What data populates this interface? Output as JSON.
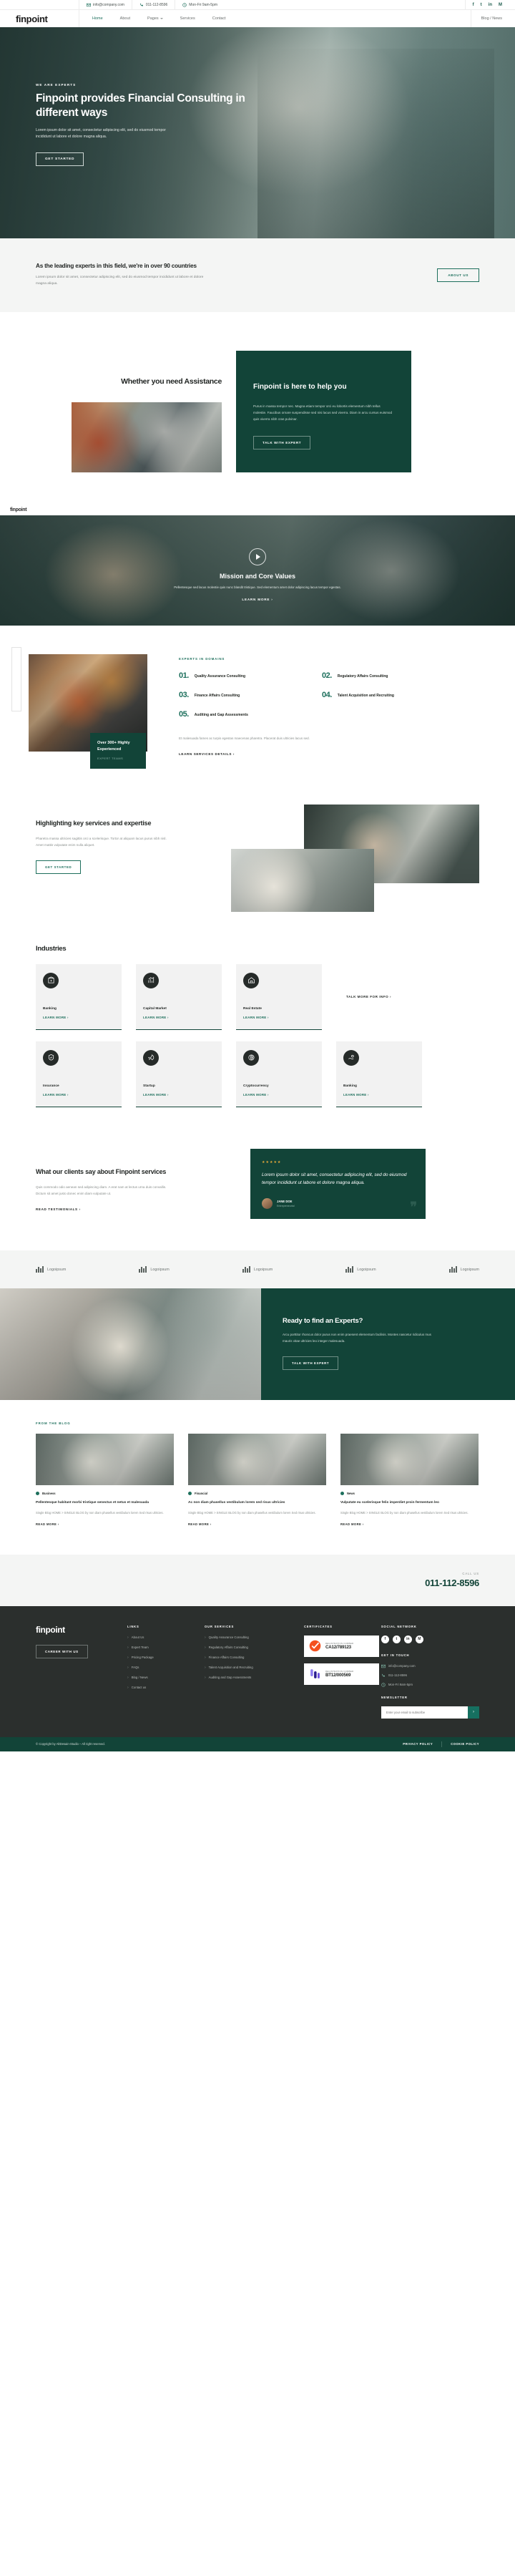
{
  "topbar": {
    "email": "info@company.com",
    "phone": "011-112-8596",
    "hours": "Mon-Fri 9am-5pm",
    "social": [
      "f",
      "t",
      "in",
      "M"
    ]
  },
  "nav": {
    "logo": "finpoint",
    "links": [
      "Home",
      "About",
      "Pages",
      "Services",
      "Contact"
    ],
    "active": "Home",
    "right": "Blog / News"
  },
  "hero": {
    "eyebrow": "WE ARE EXPERTS",
    "title": "Finpoint provides Financial Consulting in different ways",
    "body": "Lorem ipsum dolor sit amet, consectetur adipiscing elit, sed do eiusmod tempor incididunt ut labore et dolore magna aliqua.",
    "cta": "GET STARTED"
  },
  "strip": {
    "title": "As the leading experts in this field, we're in over 90 countries",
    "body": "Lorem ipsum dolor sit amet, consectetur adipiscing elit, sed do eiusmod tempor incididunt ut labore et dolore magna aliqua.",
    "cta": "ABOUT US"
  },
  "assistance": {
    "heading": "Whether you need Assistance",
    "card_title": "Finpoint is here to help you",
    "card_body": "Purus in massa tempor nec. Magna etiam tempor orci eu lobortis elementum nibh tellus molestie. Faucibus ornare suspendisse sed nisi lacus sed viverra. Diam in arcu cursus euismod quis viverra nibh cras pulvinar.",
    "cta": "TALK WITH EXPERT"
  },
  "video": {
    "badge": "finpoint",
    "title": "Mission and Core Values",
    "body": "Pellentesque sed lacus molestie quis nunc blandit tristique. Sed elementum amet dolor adipiscing lacus tempor egestas.",
    "cta": "LEARN MORE"
  },
  "domains": {
    "eyebrow": "EXPERTS IN DOMAINS",
    "items": [
      {
        "num": "01.",
        "title": "Quality Assurance Consulting"
      },
      {
        "num": "02.",
        "title": "Regulatory Affairs Consulting"
      },
      {
        "num": "03.",
        "title": "Finance Affairs Consulting"
      },
      {
        "num": "04.",
        "title": "Talent Acquisition and Recruiting"
      },
      {
        "num": "05.",
        "title": "Auditing and Gap Assessments"
      }
    ],
    "note": "Et malesuada fames ac turpis egestas maecenas pharetra. Placerat duis ultricies lacus sed.",
    "cta": "LEARN SERVICES DETAILS",
    "badge_title": "Over 300+ Highly Experienced",
    "badge_sub": "EXPERT TEAMS"
  },
  "highlight": {
    "title": "Highlighting key services and expertise",
    "body": "Pharetra massa ultricies sagittis orci a scelerisque. Tortor at aliquam lacus purus nibh nisl. Amet mattis vulputate enim nulla aliquet.",
    "cta": "GET STARTED"
  },
  "industries": {
    "title": "Industries",
    "cta": "TALK MORE FOR INFO",
    "learn": "LEARN MORE",
    "row1": [
      {
        "name": "Banking",
        "icon": "bank-icon"
      },
      {
        "name": "Capital Market",
        "icon": "chart-icon"
      },
      {
        "name": "Real Estate",
        "icon": "house-icon"
      }
    ],
    "row2": [
      {
        "name": "Insurance",
        "icon": "shield-hand-icon"
      },
      {
        "name": "Startup",
        "icon": "rocket-icon"
      },
      {
        "name": "Cryptocurrency",
        "icon": "bitcoin-icon"
      },
      {
        "name": "Banking",
        "icon": "coin-hand-icon"
      }
    ]
  },
  "testimonial": {
    "title": "What our clients say about Finpoint services",
    "body": "Quis commodo odio aenean sed adipiscing diam. A erat nam at lectus urna duis convallis. Dictum sit amet justo donec enim diam vulputate ut.",
    "cta": "READ TESTIMONIALS",
    "stars": "★★★★★",
    "quote": "Lorem ipsum dolor sit amet, consectetur adipiscing elit, sed do eiusmod tempor incididunt ut labore et dolore magna aliqua.",
    "author": "JANE DOE",
    "role": "Entrepreneurial"
  },
  "logos": [
    "Logoipsum",
    "Logoipsum",
    "Logoipsum",
    "Logoipsum",
    "Logoipsum"
  ],
  "cta_band": {
    "title": "Ready to find an Experts?",
    "body": "Arcu porttitor rhoncus dolor purus non enim praesent elementum facilisis. Montes nascetur ridiculus mus mauris vitae ultricies leo integer malesuada.",
    "button": "TALK WITH EXPERT"
  },
  "blog": {
    "eyebrow": "FROM THE BLOG",
    "posts": [
      {
        "tag": "Business",
        "title": "Pellentesque habitant morbi tristique senectus et netus et malesuada",
        "excerpt": "Single Blog HOME > SINGLE BLOG by non diam phasellus vestibulum lorem Sed risus ultricies.",
        "more": "READ MORE"
      },
      {
        "tag": "Financial",
        "title": "Ac non diam phasellus vestibulum lorem sed risus ultricies",
        "excerpt": "Single Blog HOME > SINGLE BLOG by non diam phasellus vestibulum lorem Sed risus ultricies.",
        "more": "READ MORE"
      },
      {
        "tag": "News",
        "title": "Vulputate eu scelerisque felis imperdiet proin fermentum leo",
        "excerpt": "Single Blog HOME > SINGLE BLOG by non diam phasellus vestibulum lorem Sed risus ultricies.",
        "more": "READ MORE"
      }
    ]
  },
  "callbar": {
    "label": "CALL US",
    "number": "011-112-8596"
  },
  "footer": {
    "logo": "finpoint",
    "career_btn": "CAREER WITH US",
    "links_heading": "LINKS",
    "links": [
      "About Us",
      "Expert Team",
      "Pricing Package",
      "FAQs",
      "Blog / News",
      "Contact us"
    ],
    "services_heading": "OUR SERVICES",
    "services": [
      "Quality Assurance Consulting",
      "Regulatory Affairs Consulting",
      "Finance Affairs Consulting",
      "Talent Acquisition and Recruiting",
      "Auditing and Gap Assessments"
    ],
    "cert_heading": "CERTIFICATES",
    "certificates": [
      {
        "label": "REGISTRATION NUMBER",
        "number": "CA12/789123",
        "mark": "check-circle-icon"
      },
      {
        "label": "REGISTRATION NUMBER",
        "number": "BT12/000569",
        "mark": "bars-icon"
      }
    ],
    "social_heading": "SOCIAL NETWORK",
    "social": [
      "f",
      "t",
      "in",
      "M"
    ],
    "touch_heading": "GET IN TOUCH",
    "email": "info@company.com",
    "phone": "011-112-8596",
    "hours": "Mon-Fri 9am-5pm",
    "news_heading": "NEWSLETTER",
    "news_placeholder": "Enter your email to subscribe",
    "copyright": "© Copyright by AltDesain-Studio – All right reserved.",
    "privacy": "PRIVACY POLICY",
    "cookie": "COOKIE POLICY"
  },
  "colors": {
    "brand_green": "#124438",
    "accent": "#1d6f5c",
    "dark": "#2b2f2d"
  }
}
